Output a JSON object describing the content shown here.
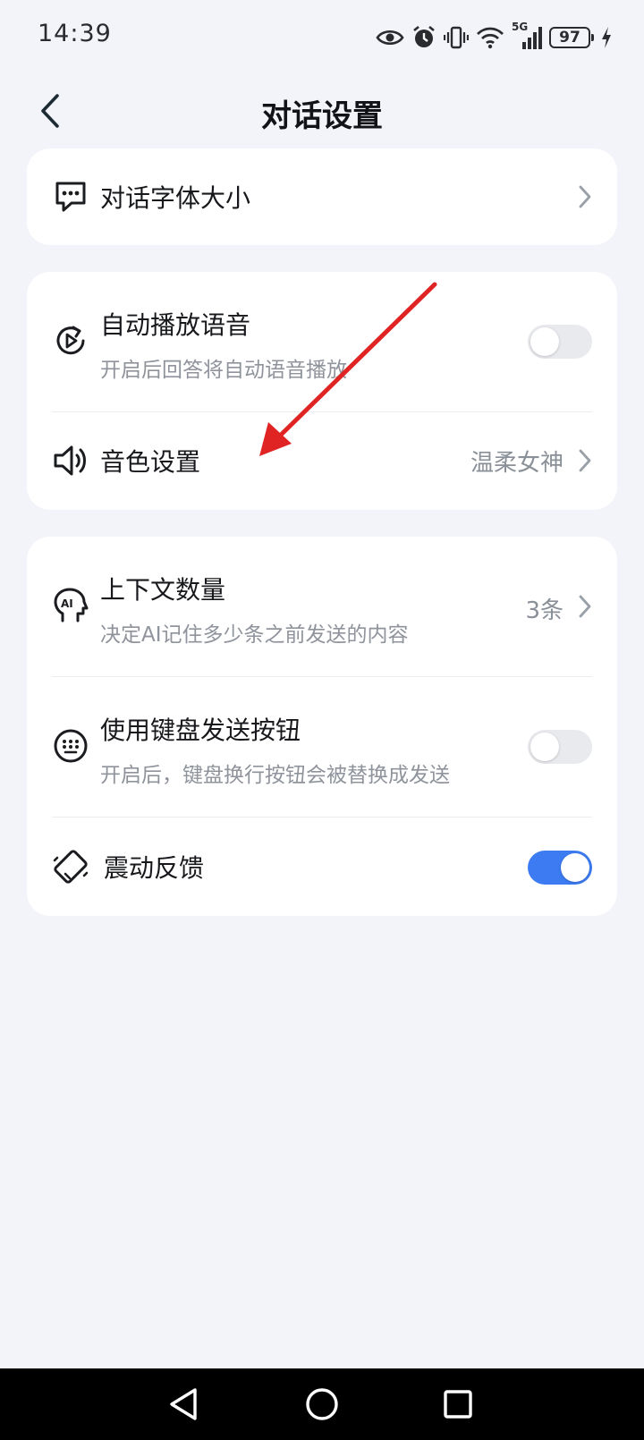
{
  "status_bar": {
    "time": "14:39",
    "network": "5G",
    "battery": "97",
    "icons": [
      "eye-icon",
      "alarm-icon",
      "vibrate-icon",
      "wifi-icon",
      "signal-icon",
      "battery-icon",
      "charging-icon"
    ]
  },
  "header": {
    "title": "对话设置",
    "back_icon": "back-arrow-icon"
  },
  "card_font": {
    "font_size_label": "对话字体大小"
  },
  "card_voice": {
    "auto_play_label": "自动播放语音",
    "auto_play_sub": "开启后回答将自动语音播放",
    "auto_play_on": false,
    "timbre_label": "音色设置",
    "timbre_value": "温柔女神"
  },
  "card_misc": {
    "context_label": "上下文数量",
    "context_sub": "决定AI记住多少条之前发送的内容",
    "context_value": "3条",
    "keyboard_label": "使用键盘发送按钮",
    "keyboard_sub": "开启后，键盘换行按钮会被替换成发送",
    "keyboard_on": false,
    "vibration_label": "震动反馈",
    "vibration_on": true
  },
  "colors": {
    "accent": "#3d7bf2",
    "background": "#f2f4f9",
    "annotation_arrow": "#e02424"
  }
}
